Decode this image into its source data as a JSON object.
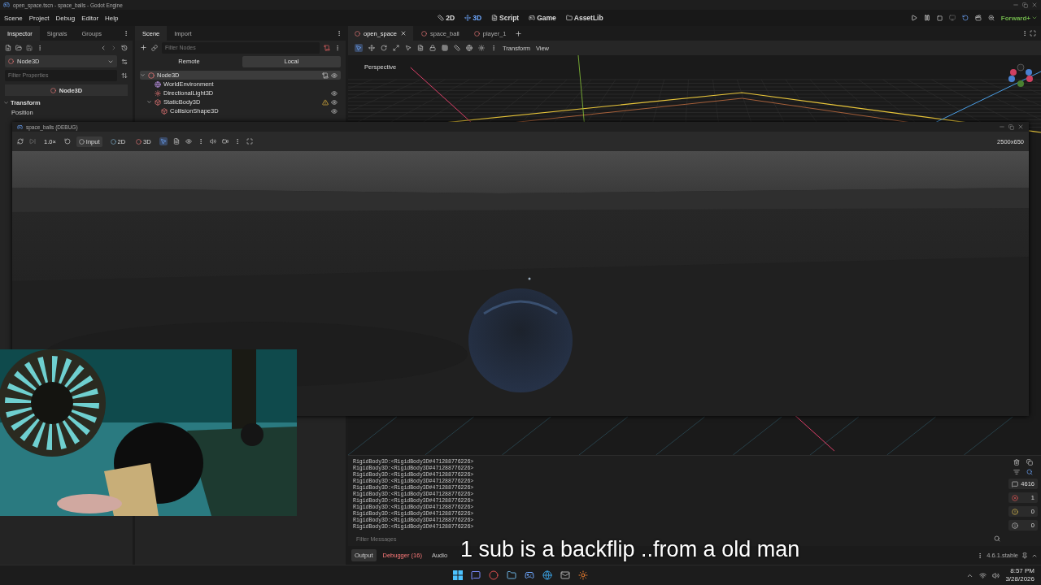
{
  "window": {
    "title": "open_space.tscn - space_balls - Godot Engine"
  },
  "menu": [
    "Scene",
    "Project",
    "Debug",
    "Editor",
    "Help"
  ],
  "main_screens": [
    {
      "label": "2D",
      "selected": false
    },
    {
      "label": "3D",
      "selected": true
    },
    {
      "label": "Script",
      "selected": false
    },
    {
      "label": "Game",
      "selected": false
    },
    {
      "label": "AssetLib",
      "selected": false
    }
  ],
  "renderer": "Forward+",
  "inspector": {
    "tabs": [
      {
        "label": "Inspector",
        "selected": true
      },
      {
        "label": "Signals",
        "selected": false
      },
      {
        "label": "Groups",
        "selected": false
      }
    ],
    "object": "Node3D",
    "filter_placeholder": "Filter Properties",
    "header": "Node3D",
    "section": "Transform",
    "property": "Position"
  },
  "scene_dock": {
    "tabs": [
      {
        "label": "Scene",
        "selected": true
      },
      {
        "label": "Import",
        "selected": false
      }
    ],
    "filter_placeholder": "Filter Nodes",
    "modes": [
      {
        "label": "Remote",
        "selected": false
      },
      {
        "label": "Local",
        "selected": true
      }
    ],
    "tree": [
      {
        "name": "Node3D",
        "kind": "node3d",
        "selected": true,
        "expanded": true,
        "script": true,
        "warning": false,
        "visibility_toggle": true,
        "children": [
          {
            "name": "WorldEnvironment",
            "kind": "environment",
            "selected": false,
            "script": false,
            "warning": false,
            "visibility_toggle": false
          },
          {
            "name": "DirectionalLight3D",
            "kind": "light",
            "selected": false,
            "script": false,
            "warning": false,
            "visibility_toggle": true
          },
          {
            "name": "StaticBody3D",
            "kind": "body",
            "selected": false,
            "expanded": true,
            "script": false,
            "warning": true,
            "visibility_toggle": true,
            "children": [
              {
                "name": "CollisionShape3D",
                "kind": "shape",
                "selected": false,
                "script": false,
                "warning": false,
                "visibility_toggle": true
              }
            ]
          }
        ]
      }
    ]
  },
  "scene_tabs": [
    {
      "label": "open_space",
      "selected": true
    },
    {
      "label": "space_ball",
      "selected": false
    },
    {
      "label": "player_1",
      "selected": false
    }
  ],
  "viewport_menus": [
    "Transform",
    "View"
  ],
  "viewport_label": "Perspective",
  "debug_window": {
    "title": "space_balls (DEBUG)",
    "speed": "1.0×",
    "modes": [
      {
        "label": "Input",
        "selected": true
      },
      {
        "label": "2D",
        "selected": false
      },
      {
        "label": "3D",
        "selected": false
      }
    ],
    "resolution": "2500x650"
  },
  "output": {
    "lines": [
      "RigidBody3D:<RigidBody3D#471288776226>",
      "RigidBody3D:<RigidBody3D#471288776226>",
      "RigidBody3D:<RigidBody3D#471288776226>",
      "RigidBody3D:<RigidBody3D#471288776226>",
      "RigidBody3D:<RigidBody3D#471288776226>",
      "RigidBody3D:<RigidBody3D#471288776226>",
      "RigidBody3D:<RigidBody3D#471288776226>",
      "RigidBody3D:<RigidBody3D#471288776226>",
      "RigidBody3D:<RigidBody3D#471288776226>",
      "RigidBody3D:<RigidBody3D#471288776226>",
      "RigidBody3D:<RigidBody3D#471288776226>"
    ],
    "filter_placeholder": "Filter Messages",
    "counters": [
      {
        "kind": "total",
        "value": "4616"
      },
      {
        "kind": "error",
        "value": "1"
      },
      {
        "kind": "warning",
        "value": "0"
      },
      {
        "kind": "info",
        "value": "0"
      }
    ]
  },
  "bottom_tabs": [
    {
      "label": "Output",
      "selected": true,
      "alert": false
    },
    {
      "label": "Debugger (16)",
      "selected": false,
      "alert": true
    },
    {
      "label": "Audio",
      "selected": false,
      "alert": false
    }
  ],
  "version": "4.6.1.stable",
  "caption": "1 sub is a backflip ..from a old man",
  "taskbar": {
    "time": "8:57 PM",
    "date": "3/28/2026"
  }
}
